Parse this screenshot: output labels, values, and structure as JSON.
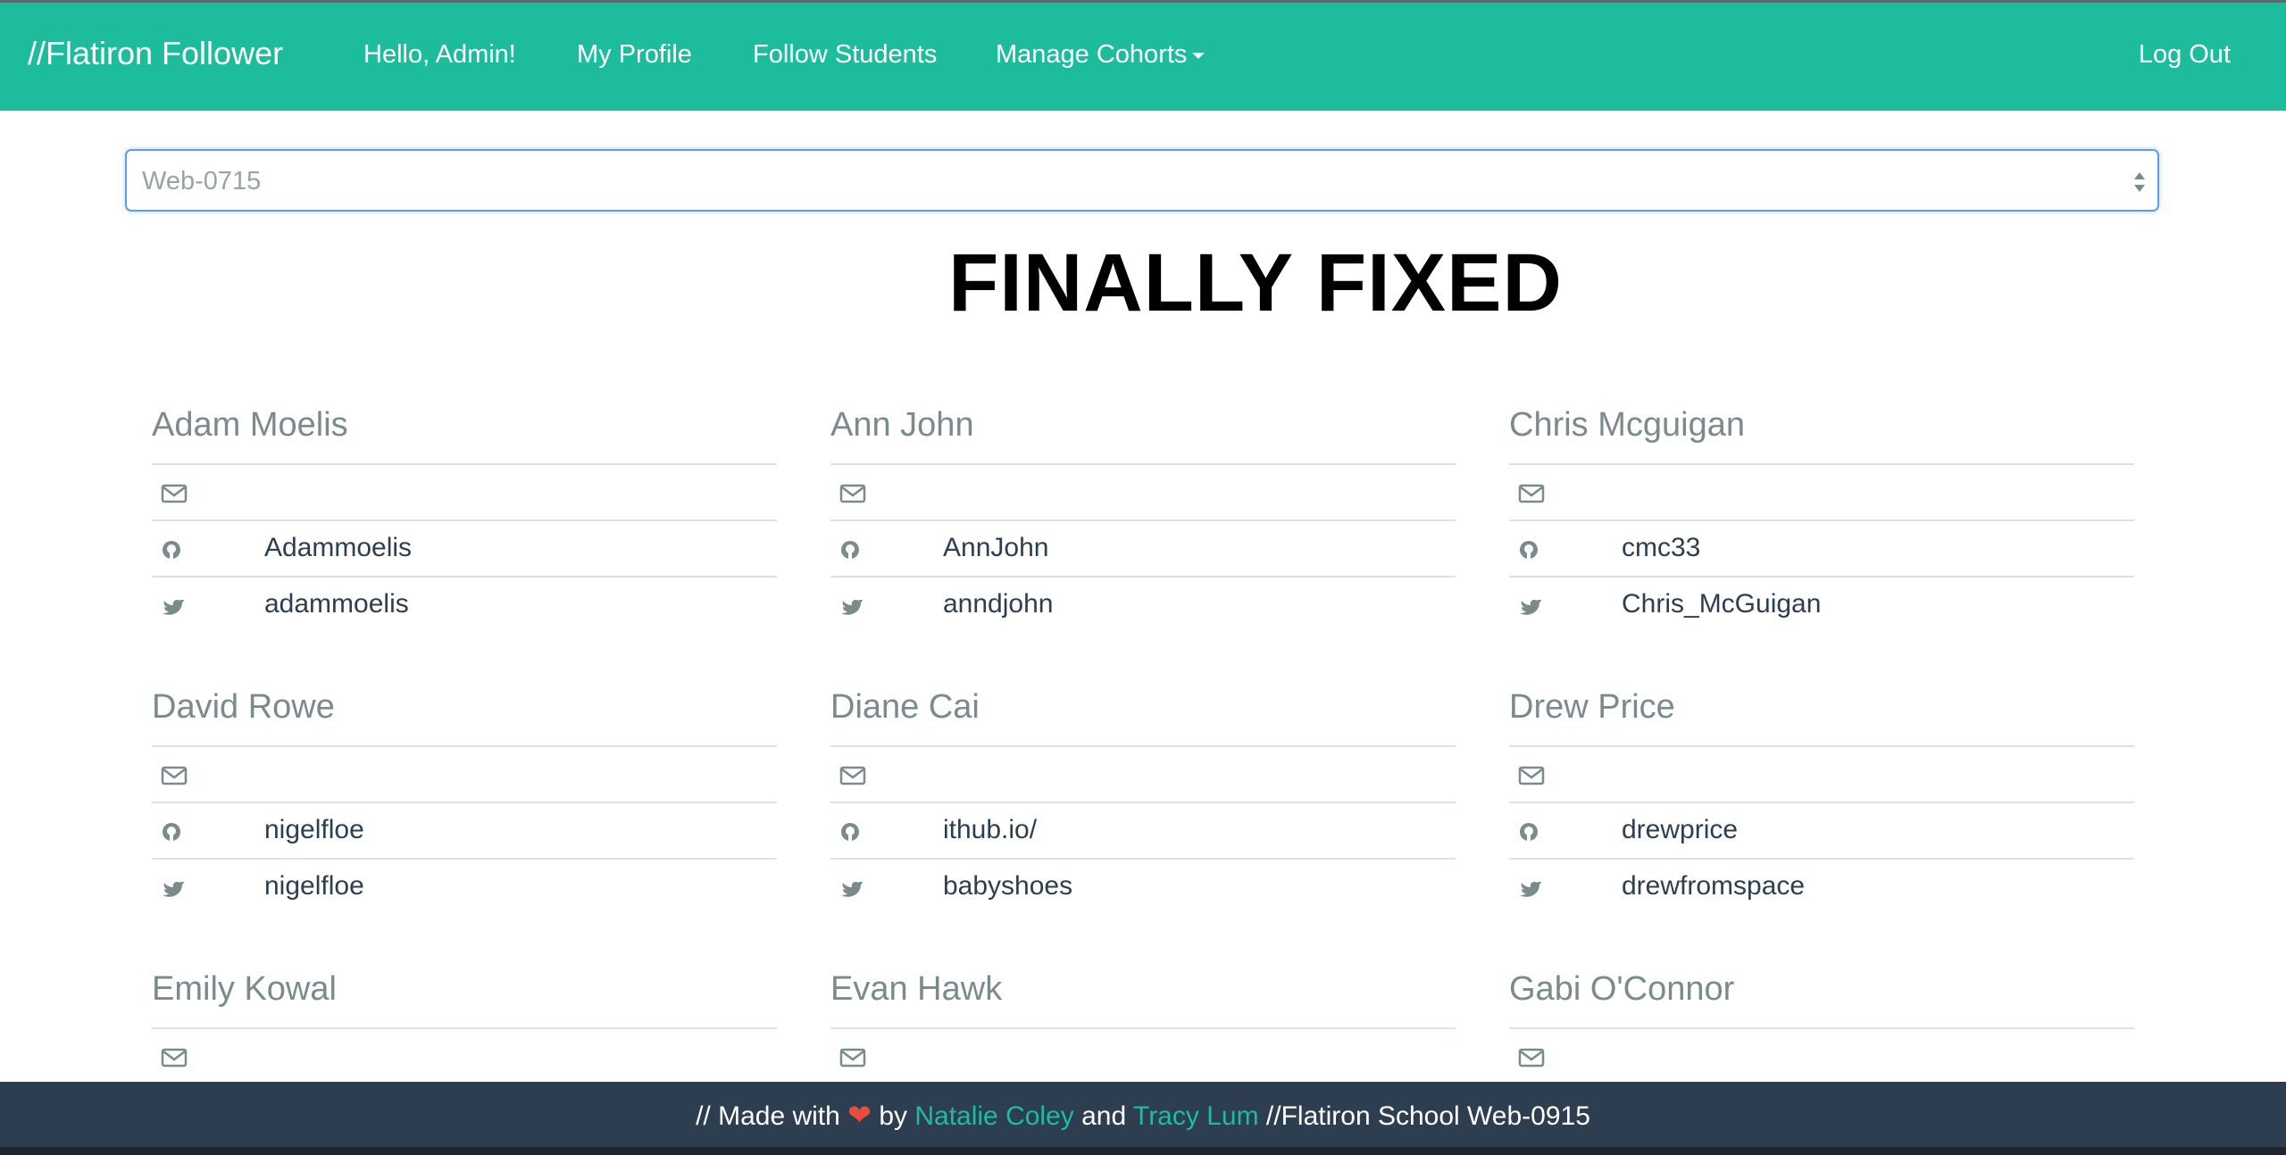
{
  "navbar": {
    "brand": "//Flatiron Follower",
    "greeting": "Hello, Admin!",
    "links": [
      "My Profile",
      "Follow Students",
      "Manage Cohorts"
    ],
    "logout": "Log Out"
  },
  "cohort_select": {
    "value": "Web-0715"
  },
  "headline": "FINALLY FIXED",
  "students": [
    {
      "name": "Adam Moelis",
      "email": "",
      "github": "Adammoelis",
      "twitter": "adammoelis"
    },
    {
      "name": "Ann John",
      "email": "",
      "github": "AnnJohn",
      "twitter": "anndjohn"
    },
    {
      "name": "Chris Mcguigan",
      "email": "",
      "github": "cmc33",
      "twitter": "Chris_McGuigan"
    },
    {
      "name": "David Rowe",
      "email": "",
      "github": "nigelfloe",
      "twitter": "nigelfloe"
    },
    {
      "name": "Diane Cai",
      "email": "",
      "github": "ithub.io/",
      "twitter": "babyshoes"
    },
    {
      "name": "Drew Price",
      "email": "",
      "github": "drewprice",
      "twitter": "drewfromspace"
    },
    {
      "name": "Emily Kowal",
      "email": ""
    },
    {
      "name": "Evan Hawk",
      "email": ""
    },
    {
      "name": "Gabi O'Connor",
      "email": ""
    }
  ],
  "footer": {
    "prefix": "// Made with",
    "by": "by",
    "author1": "Natalie Coley",
    "and": "and",
    "author2": "Tracy Lum",
    "suffix": "//Flatiron School Web-0915"
  },
  "icons": {
    "email": "envelope-icon",
    "github": "github-icon",
    "twitter": "twitter-icon",
    "love": "heart-icon"
  },
  "colors": {
    "brand": "#1dbc9c",
    "footer": "#2c3e50",
    "heart": "#e74c3c",
    "muted": "#7b8a8b"
  }
}
